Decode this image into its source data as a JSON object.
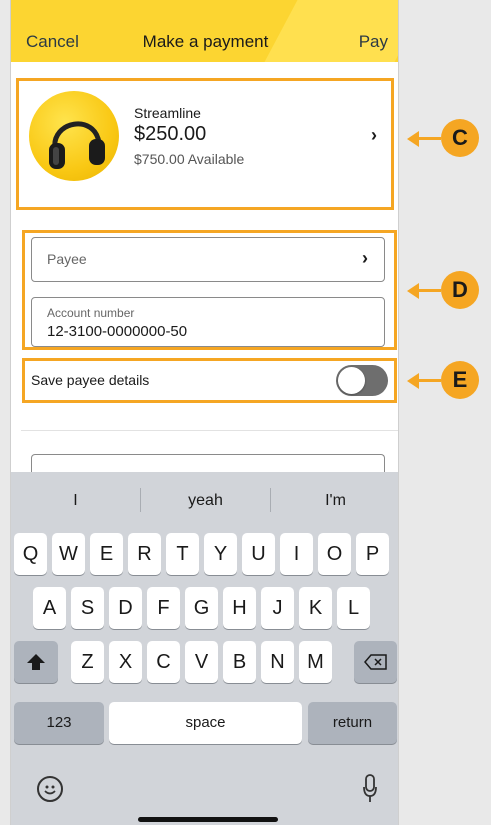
{
  "header": {
    "cancel": "Cancel",
    "title": "Make a payment",
    "pay": "Pay"
  },
  "account": {
    "name": "Streamline",
    "amount": "$250.00",
    "available": "$750.00 Available"
  },
  "payee": {
    "label": "Payee"
  },
  "account_number": {
    "label": "Account number",
    "value": "12-3100-0000000-50"
  },
  "save_payee": {
    "label": "Save payee details",
    "enabled": false
  },
  "keyboard": {
    "suggestions": [
      "I",
      "yeah",
      "I'm"
    ],
    "row1": [
      "Q",
      "W",
      "E",
      "R",
      "T",
      "Y",
      "U",
      "I",
      "O",
      "P"
    ],
    "row2": [
      "A",
      "S",
      "D",
      "F",
      "G",
      "H",
      "J",
      "K",
      "L"
    ],
    "row3": [
      "Z",
      "X",
      "C",
      "V",
      "B",
      "N",
      "M"
    ],
    "numbers_key": "123",
    "space_key": "space",
    "return_key": "return"
  },
  "callouts": [
    "C",
    "D",
    "E"
  ],
  "colors": {
    "header": "#fcd531",
    "highlight": "#f5a623",
    "toggle_off": "#6e6e6e"
  }
}
